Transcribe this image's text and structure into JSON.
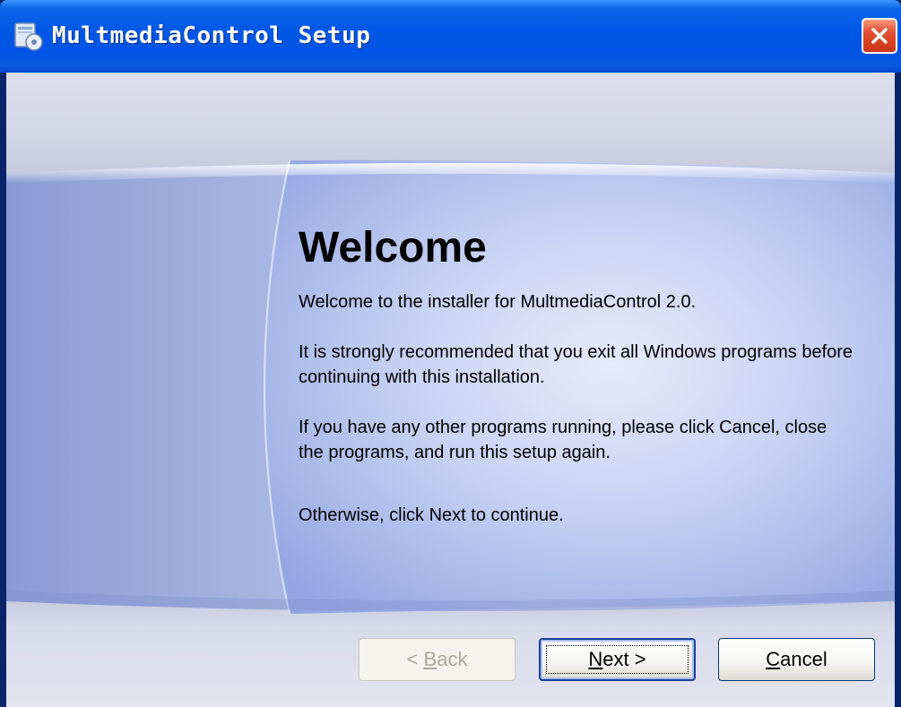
{
  "window": {
    "title": "MultmediaControl Setup",
    "icon": "setup-disc-icon",
    "close_icon": "close-x-icon"
  },
  "content": {
    "heading": "Welcome",
    "paragraph_1": "Welcome to the installer for MultmediaControl 2.0.",
    "paragraph_2": "It is strongly recommended that you exit all Windows programs before continuing with this installation.",
    "paragraph_3": "If you have any other programs running, please click Cancel, close the programs, and run this setup again.",
    "paragraph_4": "Otherwise, click Next to continue."
  },
  "buttons": {
    "back": {
      "prefix": "< ",
      "mnemonic": "B",
      "rest": "ack",
      "enabled": false
    },
    "next": {
      "prefix": "",
      "mnemonic": "N",
      "rest": "ext >",
      "enabled": true,
      "default": true
    },
    "cancel": {
      "prefix": "",
      "mnemonic": "C",
      "rest": "ancel",
      "enabled": true
    }
  },
  "colors": {
    "titlebar_blue": "#0054e3",
    "close_red": "#d8401c",
    "panel_blue": "#a9b8ec",
    "dialog_face": "#ece9d8"
  }
}
